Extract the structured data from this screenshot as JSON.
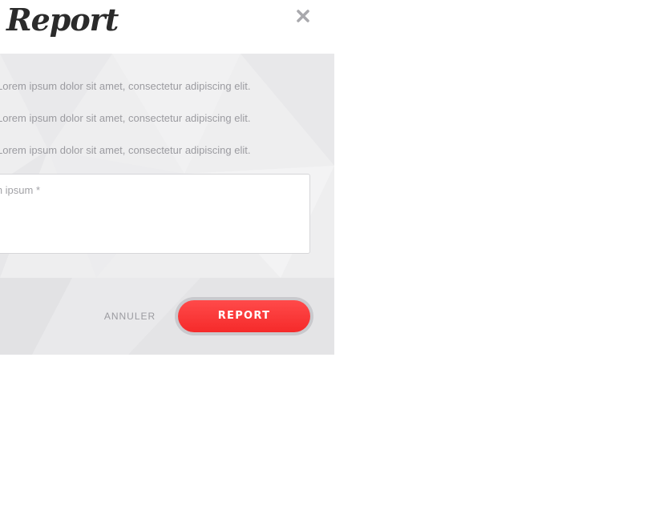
{
  "dialog": {
    "title": "Report",
    "close_icon": "close-icon"
  },
  "options": [
    {
      "label": "Lorem ipsum dolor sit amet, consectetur adipiscing elit."
    },
    {
      "label": "Lorem ipsum dolor sit amet, consectetur adipiscing elit."
    },
    {
      "label": "Lorem ipsum dolor sit amet, consectetur adipiscing elit."
    }
  ],
  "comment": {
    "placeholder": "em ipsum *",
    "value": ""
  },
  "footer": {
    "cancel_label": "ANNULER",
    "submit_label": "REPORT"
  },
  "colors": {
    "accent": "#ff3a3a",
    "title": "#2b2b2b",
    "muted_text": "#9b9ba0",
    "body_bg": "#eeeeef",
    "footer_bg": "#e6e6e8"
  }
}
